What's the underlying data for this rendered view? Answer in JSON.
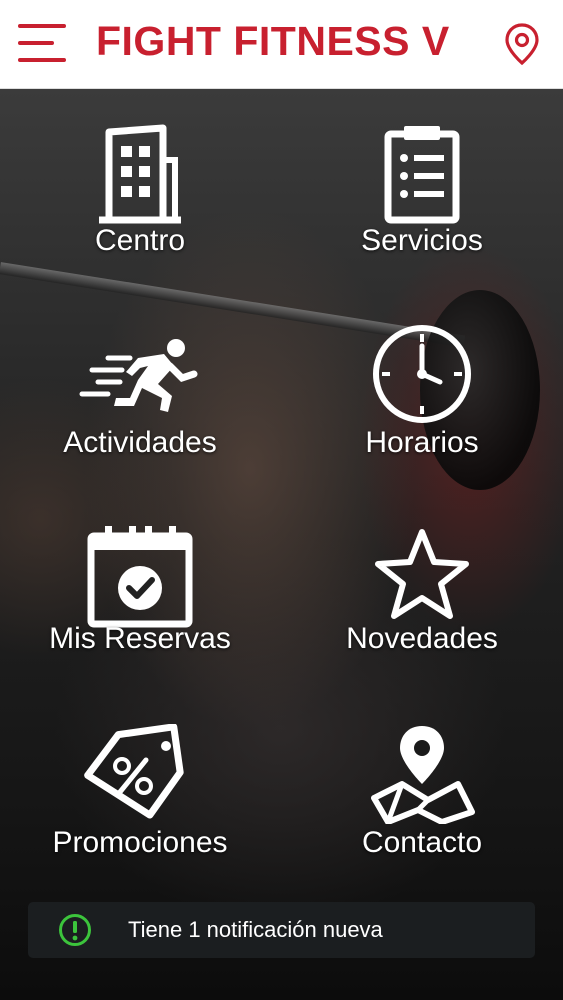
{
  "header": {
    "title": "FIGHT FITNESS V",
    "menu_icon": "hamburger-menu-icon",
    "location_icon": "map-pin-icon",
    "accent_color": "#c8202f"
  },
  "tiles": [
    {
      "label": "Centro",
      "icon": "building-icon"
    },
    {
      "label": "Servicios",
      "icon": "clipboard-list-icon"
    },
    {
      "label": "Actividades",
      "icon": "running-person-icon"
    },
    {
      "label": "Horarios",
      "icon": "clock-icon"
    },
    {
      "label": "Mis Reservas",
      "icon": "calendar-check-icon"
    },
    {
      "label": "Novedades",
      "icon": "star-icon"
    },
    {
      "label": "Promociones",
      "icon": "discount-tag-icon"
    },
    {
      "label": "Contacto",
      "icon": "map-location-icon"
    }
  ],
  "notification": {
    "text": "Tiene 1 notificación nueva",
    "icon": "exclamation-circle-icon",
    "icon_color": "#3cc43c"
  }
}
